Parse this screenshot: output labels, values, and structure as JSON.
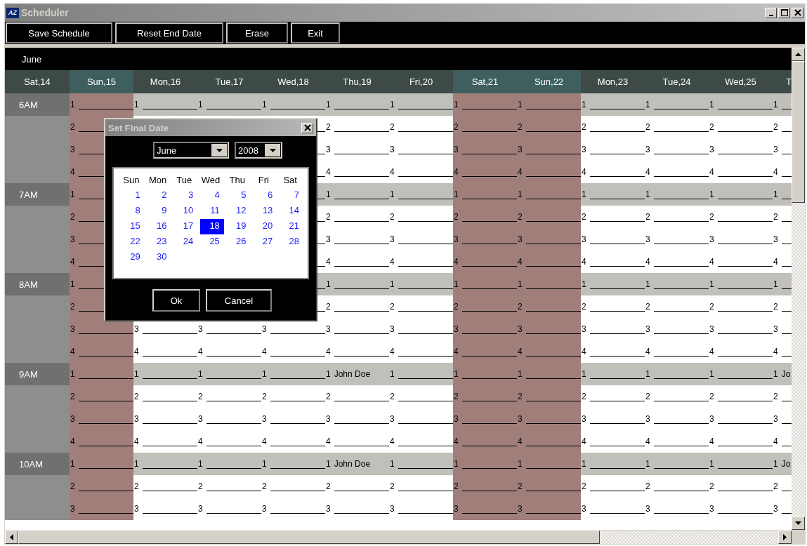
{
  "window": {
    "icon_label": "AZ",
    "title": "Scheduler"
  },
  "toolbar": {
    "buttons": [
      "Save Schedule",
      "Reset End Date",
      "Erase",
      "Exit"
    ]
  },
  "grid": {
    "month": "June",
    "day_headers": [
      {
        "label": "Sat,14",
        "highlighted": false
      },
      {
        "label": "Sun,15",
        "highlighted": true
      },
      {
        "label": "Mon,16",
        "highlighted": false
      },
      {
        "label": "Tue,17",
        "highlighted": false
      },
      {
        "label": "Wed,18",
        "highlighted": false
      },
      {
        "label": "Thu,19",
        "highlighted": false
      },
      {
        "label": "Fri,20",
        "highlighted": false
      },
      {
        "label": "Sat,21",
        "highlighted": true
      },
      {
        "label": "Sun,22",
        "highlighted": true
      },
      {
        "label": "Mon,23",
        "highlighted": false
      },
      {
        "label": "Tue,24",
        "highlighted": false
      },
      {
        "label": "Wed,25",
        "highlighted": false
      },
      {
        "label": "T",
        "highlighted": false
      }
    ],
    "rows": [
      {
        "hour": "6AM",
        "cells": [
          {
            "slot": "1"
          },
          {
            "slot": "1"
          },
          {
            "slot": "1"
          },
          {
            "slot": "1"
          },
          {
            "slot": "1"
          },
          {
            "slot": "1"
          },
          {
            "slot": "1"
          },
          {
            "slot": "1"
          },
          {
            "slot": "1"
          },
          {
            "slot": "1"
          },
          {
            "slot": "1"
          },
          {
            "slot": "1"
          }
        ]
      },
      {
        "cells": [
          {
            "slot": "2"
          },
          null,
          null,
          null,
          {
            "slot": "2"
          },
          {
            "slot": "2"
          },
          {
            "slot": "2"
          },
          {
            "slot": "2"
          },
          {
            "slot": "2"
          },
          {
            "slot": "2"
          },
          {
            "slot": "2"
          },
          {
            "slot": "2"
          }
        ]
      },
      {
        "cells": [
          {
            "slot": "3"
          },
          null,
          null,
          null,
          {
            "slot": "3"
          },
          {
            "slot": "3"
          },
          {
            "slot": "3"
          },
          {
            "slot": "3"
          },
          {
            "slot": "3"
          },
          {
            "slot": "3"
          },
          {
            "slot": "3"
          },
          {
            "slot": "3"
          }
        ]
      },
      {
        "cells": [
          {
            "slot": "4"
          },
          null,
          null,
          null,
          {
            "slot": "4"
          },
          {
            "slot": "4"
          },
          {
            "slot": "4"
          },
          {
            "slot": "4"
          },
          {
            "slot": "4"
          },
          {
            "slot": "4"
          },
          {
            "slot": "4"
          },
          {
            "slot": "4"
          }
        ]
      },
      {
        "hour": "7AM",
        "cells": [
          {
            "slot": "1"
          },
          null,
          null,
          null,
          {
            "slot": "1"
          },
          {
            "slot": "1"
          },
          {
            "slot": "1"
          },
          {
            "slot": "1"
          },
          {
            "slot": "1"
          },
          {
            "slot": "1"
          },
          {
            "slot": "1"
          },
          {
            "slot": "1"
          }
        ]
      },
      {
        "cells": [
          {
            "slot": "2"
          },
          null,
          null,
          null,
          {
            "slot": "2"
          },
          {
            "slot": "2"
          },
          {
            "slot": "2"
          },
          {
            "slot": "2"
          },
          {
            "slot": "2"
          },
          {
            "slot": "2"
          },
          {
            "slot": "2"
          },
          {
            "slot": "2"
          }
        ]
      },
      {
        "cells": [
          {
            "slot": "3"
          },
          null,
          null,
          null,
          {
            "slot": "3"
          },
          {
            "slot": "3"
          },
          {
            "slot": "3"
          },
          {
            "slot": "3"
          },
          {
            "slot": "3"
          },
          {
            "slot": "3"
          },
          {
            "slot": "3"
          },
          {
            "slot": "3"
          }
        ]
      },
      {
        "cells": [
          {
            "slot": "4"
          },
          null,
          null,
          null,
          {
            "slot": "4"
          },
          {
            "slot": "4"
          },
          {
            "slot": "4"
          },
          {
            "slot": "4"
          },
          {
            "slot": "4"
          },
          {
            "slot": "4"
          },
          {
            "slot": "4"
          },
          {
            "slot": "4"
          }
        ]
      },
      {
        "hour": "8AM",
        "cells": [
          {
            "slot": "1"
          },
          null,
          null,
          null,
          {
            "slot": "1"
          },
          {
            "slot": "1"
          },
          {
            "slot": "1"
          },
          {
            "slot": "1"
          },
          {
            "slot": "1"
          },
          {
            "slot": "1"
          },
          {
            "slot": "1"
          },
          {
            "slot": "1"
          }
        ]
      },
      {
        "cells": [
          {
            "slot": "2"
          },
          null,
          null,
          null,
          {
            "slot": "2"
          },
          {
            "slot": "2"
          },
          {
            "slot": "2"
          },
          {
            "slot": "2"
          },
          {
            "slot": "2"
          },
          {
            "slot": "2"
          },
          {
            "slot": "2"
          },
          {
            "slot": "2"
          }
        ]
      },
      {
        "cells": [
          {
            "slot": "3"
          },
          {
            "slot": "3"
          },
          {
            "slot": "3"
          },
          {
            "slot": "3"
          },
          {
            "slot": "3"
          },
          {
            "slot": "3"
          },
          {
            "slot": "3"
          },
          {
            "slot": "3"
          },
          {
            "slot": "3"
          },
          {
            "slot": "3"
          },
          {
            "slot": "3"
          },
          {
            "slot": "3"
          }
        ]
      },
      {
        "cells": [
          {
            "slot": "4"
          },
          {
            "slot": "4"
          },
          {
            "slot": "4"
          },
          {
            "slot": "4"
          },
          {
            "slot": "4"
          },
          {
            "slot": "4"
          },
          {
            "slot": "4"
          },
          {
            "slot": "4"
          },
          {
            "slot": "4"
          },
          {
            "slot": "4"
          },
          {
            "slot": "4"
          },
          {
            "slot": "4"
          }
        ]
      },
      {
        "hour": "9AM",
        "cells": [
          {
            "slot": "1"
          },
          {
            "slot": "1"
          },
          {
            "slot": "1"
          },
          {
            "slot": "1"
          },
          {
            "slot": "1",
            "name": "John Doe"
          },
          {
            "slot": "1"
          },
          {
            "slot": "1"
          },
          {
            "slot": "1"
          },
          {
            "slot": "1"
          },
          {
            "slot": "1"
          },
          {
            "slot": "1"
          },
          {
            "slot": "1",
            "name": "Jo"
          }
        ]
      },
      {
        "cells": [
          {
            "slot": "2"
          },
          {
            "slot": "2"
          },
          {
            "slot": "2"
          },
          {
            "slot": "2"
          },
          {
            "slot": "2"
          },
          {
            "slot": "2"
          },
          {
            "slot": "2"
          },
          {
            "slot": "2"
          },
          {
            "slot": "2"
          },
          {
            "slot": "2"
          },
          {
            "slot": "2"
          },
          {
            "slot": "2"
          }
        ]
      },
      {
        "cells": [
          {
            "slot": "3"
          },
          {
            "slot": "3"
          },
          {
            "slot": "3"
          },
          {
            "slot": "3"
          },
          {
            "slot": "3"
          },
          {
            "slot": "3"
          },
          {
            "slot": "3"
          },
          {
            "slot": "3"
          },
          {
            "slot": "3"
          },
          {
            "slot": "3"
          },
          {
            "slot": "3"
          },
          {
            "slot": "3"
          }
        ]
      },
      {
        "cells": [
          {
            "slot": "4"
          },
          {
            "slot": "4"
          },
          {
            "slot": "4"
          },
          {
            "slot": "4"
          },
          {
            "slot": "4"
          },
          {
            "slot": "4"
          },
          {
            "slot": "4"
          },
          {
            "slot": "4"
          },
          {
            "slot": "4"
          },
          {
            "slot": "4"
          },
          {
            "slot": "4"
          },
          {
            "slot": "4"
          }
        ]
      },
      {
        "hour": "10AM",
        "cells": [
          {
            "slot": "1"
          },
          {
            "slot": "1"
          },
          {
            "slot": "1"
          },
          {
            "slot": "1"
          },
          {
            "slot": "1",
            "name": "John Doe"
          },
          {
            "slot": "1"
          },
          {
            "slot": "1"
          },
          {
            "slot": "1"
          },
          {
            "slot": "1"
          },
          {
            "slot": "1"
          },
          {
            "slot": "1"
          },
          {
            "slot": "1",
            "name": "Jo"
          }
        ]
      },
      {
        "cells": [
          {
            "slot": "2"
          },
          {
            "slot": "2"
          },
          {
            "slot": "2"
          },
          {
            "slot": "2"
          },
          {
            "slot": "2"
          },
          {
            "slot": "2"
          },
          {
            "slot": "2"
          },
          {
            "slot": "2"
          },
          {
            "slot": "2"
          },
          {
            "slot": "2"
          },
          {
            "slot": "2"
          },
          {
            "slot": "2"
          }
        ]
      },
      {
        "cells": [
          {
            "slot": "3"
          },
          {
            "slot": "3"
          },
          {
            "slot": "3"
          },
          {
            "slot": "3"
          },
          {
            "slot": "3"
          },
          {
            "slot": "3"
          },
          {
            "slot": "3"
          },
          {
            "slot": "3"
          },
          {
            "slot": "3"
          },
          {
            "slot": "3"
          },
          {
            "slot": "3"
          },
          {
            "slot": "3"
          }
        ]
      }
    ]
  },
  "dialog": {
    "title": "Set Final Date",
    "month": "June",
    "year": "2008",
    "weekdays": [
      "Sun",
      "Mon",
      "Tue",
      "Wed",
      "Thu",
      "Fri",
      "Sat"
    ],
    "days": [
      {
        "label": "1",
        "selected": false
      },
      {
        "label": "2",
        "selected": false
      },
      {
        "label": "3",
        "selected": false
      },
      {
        "label": "4",
        "selected": false
      },
      {
        "label": "5",
        "selected": false
      },
      {
        "label": "6",
        "selected": false
      },
      {
        "label": "7",
        "selected": false
      },
      {
        "label": "8",
        "selected": false
      },
      {
        "label": "9",
        "selected": false
      },
      {
        "label": "10",
        "selected": false
      },
      {
        "label": "11",
        "selected": false
      },
      {
        "label": "12",
        "selected": false
      },
      {
        "label": "13",
        "selected": false
      },
      {
        "label": "14",
        "selected": false
      },
      {
        "label": "15",
        "selected": false
      },
      {
        "label": "16",
        "selected": false
      },
      {
        "label": "17",
        "selected": false
      },
      {
        "label": "18",
        "selected": true
      },
      {
        "label": "19",
        "selected": false
      },
      {
        "label": "20",
        "selected": false
      },
      {
        "label": "21",
        "selected": false
      },
      {
        "label": "22",
        "selected": false
      },
      {
        "label": "23",
        "selected": false
      },
      {
        "label": "24",
        "selected": false
      },
      {
        "label": "25",
        "selected": false
      },
      {
        "label": "26",
        "selected": false
      },
      {
        "label": "27",
        "selected": false
      },
      {
        "label": "28",
        "selected": false
      },
      {
        "label": "29",
        "selected": false
      },
      {
        "label": "30",
        "selected": false
      }
    ],
    "buttons": [
      "Ok",
      "Cancel"
    ]
  }
}
